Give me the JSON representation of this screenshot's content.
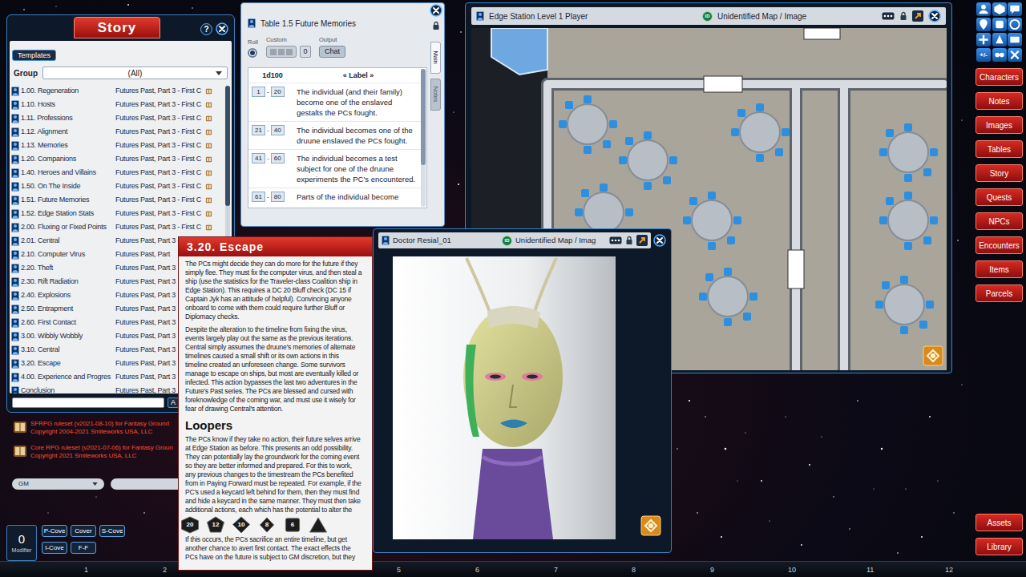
{
  "story": {
    "title": "Story",
    "help": "?",
    "templates_button": "Templates",
    "group_label": "Group",
    "group_value": "(All)",
    "search_button": "A",
    "rows": [
      {
        "name": "1.00. Regeneration",
        "source": "Futures Past, Part 3 - First C"
      },
      {
        "name": "1.10. Hosts",
        "source": "Futures Past, Part 3 - First C"
      },
      {
        "name": "1.11. Professions",
        "source": "Futures Past, Part 3 - First C"
      },
      {
        "name": "1.12. Alignment",
        "source": "Futures Past, Part 3 - First C"
      },
      {
        "name": "1.13. Memories",
        "source": "Futures Past, Part 3 - First C"
      },
      {
        "name": "1.20. Companions",
        "source": "Futures Past, Part 3 - First C"
      },
      {
        "name": "1.40. Heroes and Villains",
        "source": "Futures Past, Part 3 - First C"
      },
      {
        "name": "1.50. On The Inside",
        "source": "Futures Past, Part 3 - First C"
      },
      {
        "name": "1.51. Future Memories",
        "source": "Futures Past, Part 3 - First C"
      },
      {
        "name": "1.52. Edge Station Stats",
        "source": "Futures Past, Part 3 - First C"
      },
      {
        "name": "2.00. Fluxing or Fixed Points",
        "source": "Futures Past, Part 3 - First C"
      },
      {
        "name": "2.01. Central",
        "source": "Futures Past, Part 3 - First C"
      },
      {
        "name": "2.10. Computer Virus",
        "source": "Futures Past, Part"
      },
      {
        "name": "2.20. Theft",
        "source": "Futures Past, Part 3"
      },
      {
        "name": "2.30. Rift Radiation",
        "source": "Futures Past, Part 3"
      },
      {
        "name": "2.40. Explosions",
        "source": "Futures Past, Part 3"
      },
      {
        "name": "2.50. Entrapment",
        "source": "Futures Past, Part 3"
      },
      {
        "name": "2.60. First Contact",
        "source": "Futures Past, Part 3"
      },
      {
        "name": "3.00. Wibbly Wobbly",
        "source": "Futures Past, Part 3"
      },
      {
        "name": "3.10. Central",
        "source": "Futures Past, Part 3"
      },
      {
        "name": "3.20. Escape",
        "source": "Futures Past, Part 3"
      },
      {
        "name": "4.00. Experience and Progres",
        "source": "Futures Past, Part 3"
      },
      {
        "name": "Conclusion",
        "source": "Futures Past, Part 3"
      }
    ]
  },
  "modules": [
    {
      "name": "SFRPG ruleset (v2021-08-10) for Fantasy Ground",
      "copyright": "Copyright 2004-2021 Smiteworks USA, LLC"
    },
    {
      "name": "Core RPG ruleset (v2021-07-06) for Fantasy Groun",
      "copyright": "Copyright 2021 Smiteworks USA, LLC"
    }
  ],
  "identity": {
    "value": "GM"
  },
  "modifier": {
    "value": "0",
    "label": "Modifier"
  },
  "cover_buttons": [
    "P-Cove",
    "Cover",
    "S-Cove",
    "I-Cove",
    "F-F"
  ],
  "dice": [
    {
      "kind": "d20",
      "label": "20"
    },
    {
      "kind": "d12",
      "label": "12"
    },
    {
      "kind": "d10",
      "label": "10"
    },
    {
      "kind": "d8",
      "label": "8"
    },
    {
      "kind": "d6",
      "label": "6"
    },
    {
      "kind": "d4"
    }
  ],
  "table_window": {
    "title": "Table 1.5 Future Memories",
    "roll_label": "Roll",
    "roll_selected": true,
    "custom_label": "Custom",
    "custom_value": "0",
    "output_label": "Output",
    "output_button": "Chat",
    "dice_header": "1d100",
    "label_header": "« Label »",
    "range_separator": "-",
    "side_tabs": [
      {
        "label": "Main",
        "selected": true
      },
      {
        "label": "Notes",
        "selected": false
      }
    ],
    "rows": [
      {
        "from": "1",
        "to": "20",
        "text": "The individual (and their family) become one of the enslaved gestalts the PCs fought."
      },
      {
        "from": "21",
        "to": "40",
        "text": "The individual becomes one of the druune enslaved the PCs fought."
      },
      {
        "from": "41",
        "to": "60",
        "text": "The individual becomes a test subject for one of the druune experiments the PC's encountered."
      },
      {
        "from": "61",
        "to": "80",
        "text": "Parts of the individual become"
      }
    ]
  },
  "map_window": {
    "title": "Edge Station Level 1 Player",
    "id_badge": "ID",
    "status": "Unidentified Map / Image"
  },
  "image_window": {
    "title": "Doctor Resial_01",
    "id_badge": "ID",
    "status": "Unidentified Map / Imag"
  },
  "story_entry": {
    "title": "3.20. Escape",
    "blocks": [
      {
        "kind": "paragraph",
        "lines": [
          "The PCs might decide they can do more for the future if they",
          "simply flee. They must fix the computer virus, and then steal a",
          "ship (use the statistics for the Traveler-class Coalition ship in",
          "Edge Station). This requires a DC 20 Bluff check (DC 15 if",
          "Captain Jyk has an attitude of helpful). Convincing anyone",
          "onboard to come with them could require further Bluff or",
          "Diplomacy checks."
        ]
      },
      {
        "kind": "paragraph",
        "lines": [
          "Despite the alteration to the timeline from fixing the virus,",
          "events largely play out the same as the previous iterations.",
          "Central simply assumes the druune's memories of alternate",
          "timelines caused a small shift or its own actions in this",
          "timeline created an unforeseen change. Some survivors",
          "manage to escape on ships, but most are eventually killed or",
          "infected. This action bypasses the last two adventures in the",
          "Future's Past series. The PCs are blessed and cursed with",
          "foreknowledge of the coming war, and must use it wisely for",
          "fear of drawing Central's attention."
        ]
      },
      {
        "kind": "heading",
        "text": "Loopers"
      },
      {
        "kind": "paragraph",
        "lines": [
          "The PCs know if they take no action, their future selves arrive",
          "at Edge Station as before. This presents an odd possibility.",
          "They can potentially lay the groundwork for the coming event",
          "so they are better informed and prepared. For this to work,",
          "any previous changes to the timestream the PCs benefited",
          "from in Paying Forward must be repeated. For example, if the",
          "PC's used a keycard left behind for them, then they must find",
          "and hide a keycard in the same manner. They must then take",
          "additional actions, each which has the potential to alter the"
        ]
      },
      {
        "kind": "paragraph",
        "lines": [
          "If this occurs, the PCs sacrifice an entire timeline, but get",
          "another chance to avert first contact. The exact effects the",
          "PCs have on the future is subject to GM discretion, but they"
        ]
      }
    ]
  },
  "sidebar": {
    "tool_label": "+/-",
    "buttons": [
      "Characters",
      "Notes",
      "Images",
      "Tables",
      "Story",
      "Quests",
      "NPCs",
      "Encounters",
      "Items",
      "Parcels"
    ],
    "bottom_buttons": [
      "Assets",
      "Library"
    ]
  },
  "hotbar": [
    "1",
    "2",
    "5",
    "6",
    "7",
    "8",
    "9",
    "10",
    "11",
    "12"
  ]
}
